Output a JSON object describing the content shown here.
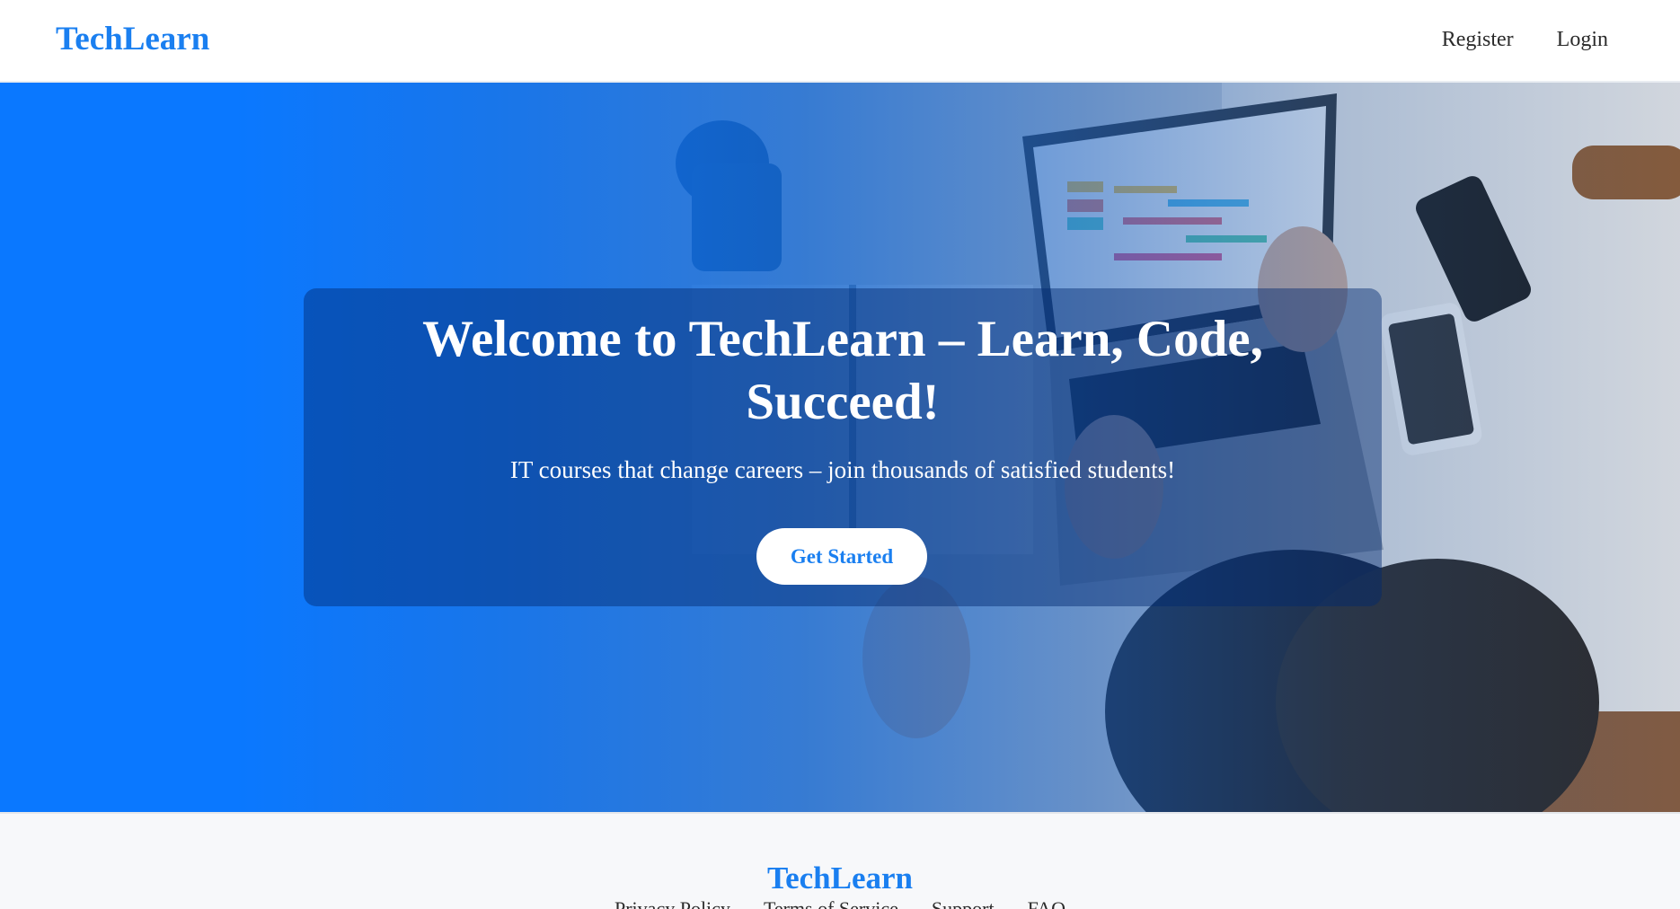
{
  "header": {
    "brand": "TechLearn",
    "nav": {
      "register": "Register",
      "login": "Login"
    }
  },
  "hero": {
    "title": "Welcome to TechLearn – Learn, Code, Succeed!",
    "subtitle": "IT courses that change careers – join thousands of satisfied students!",
    "cta_label": "Get Started"
  },
  "footer": {
    "brand": "TechLearn",
    "links": {
      "privacy": "Privacy Policy",
      "terms": "Terms of Service",
      "support": "Support",
      "faq": "FAQ"
    }
  },
  "colors": {
    "brand": "#1a7ff0",
    "hero_blue": "#0a78ff",
    "footer_bg": "#f7f8fa"
  }
}
